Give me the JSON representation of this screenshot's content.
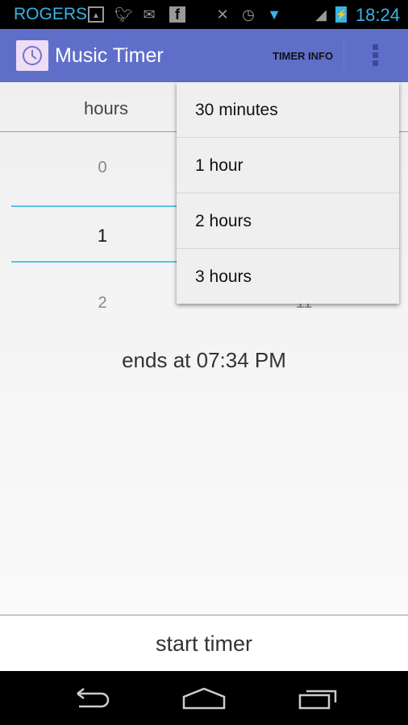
{
  "status_bar": {
    "carrier": "ROGERS",
    "time": "18:24",
    "icons": [
      "image-icon",
      "twitter-icon",
      "gmail-icon",
      "facebook-icon",
      "mute-icon",
      "alarm-icon",
      "wifi-icon",
      "signal-icon",
      "battery-charging-icon"
    ]
  },
  "app_bar": {
    "title": "Music Timer",
    "timer_info": "TIMER INFO",
    "accent": "#5f6fc9"
  },
  "picker": {
    "hours_label": "hours",
    "hours": [
      "0",
      "1",
      "2"
    ],
    "minutes_partial": "11",
    "selector_color": "#5bc0e6"
  },
  "ends_at": "ends at 07:34 PM",
  "start_button": "start timer",
  "menu": {
    "items": [
      "30 minutes",
      "1 hour",
      "2 hours",
      "3 hours"
    ]
  }
}
